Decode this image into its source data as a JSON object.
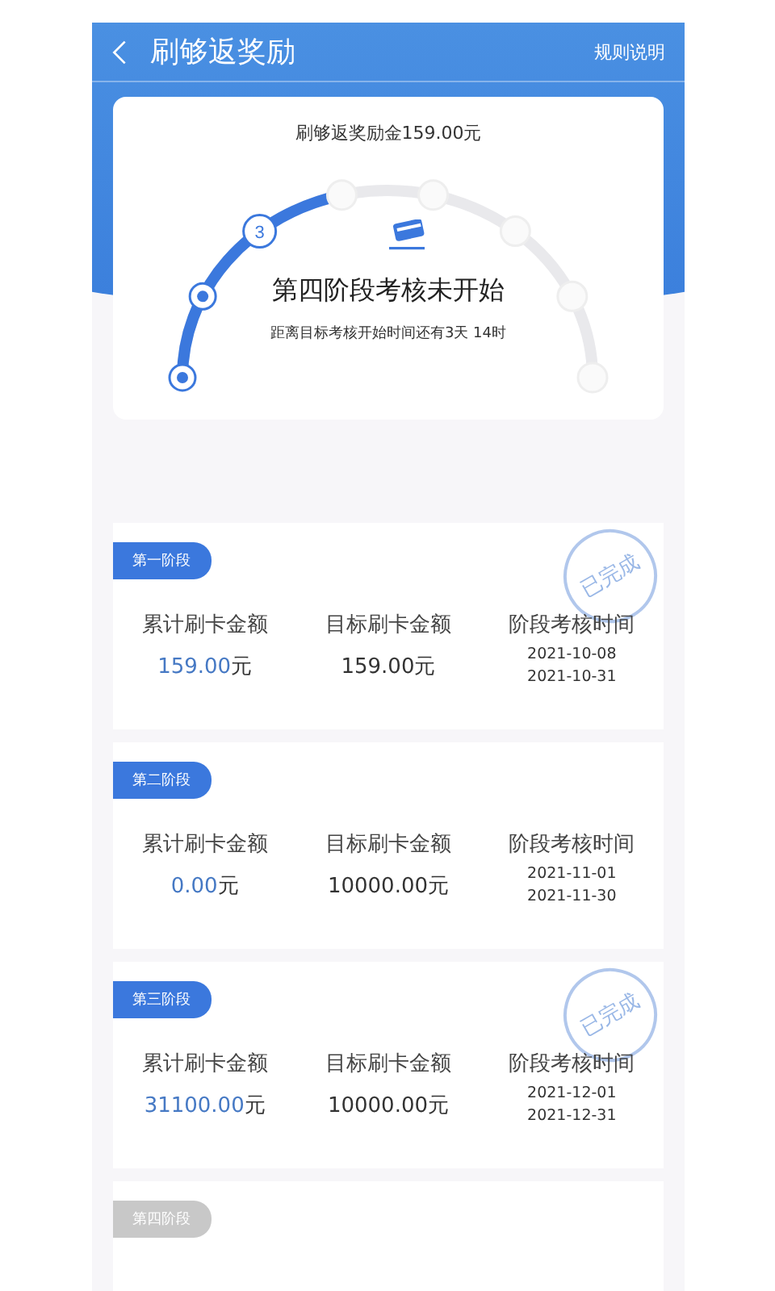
{
  "header": {
    "title": "刷够返奖励",
    "link": "规则说明"
  },
  "summary": {
    "reward": "刷够返奖励金159.00元",
    "status": "第四阶段考核未开始",
    "countdown": "距离目标考核开始时间还有3天 14时"
  },
  "progress": {
    "level": 0.43,
    "nodes": [
      {
        "kind": "done"
      },
      {
        "kind": "done"
      },
      {
        "kind": "current",
        "label": "3"
      },
      {
        "kind": "pending"
      },
      {
        "kind": "pending"
      },
      {
        "kind": "pending"
      },
      {
        "kind": "pending"
      },
      {
        "kind": "pending"
      }
    ]
  },
  "stages": [
    {
      "badge": "第一阶段",
      "active": true,
      "stamp": "已完成",
      "headings": [
        "累计刷卡金额",
        "目标刷卡金额",
        "阶段考核时间"
      ],
      "amount": "159.00",
      "amount_unit": "元",
      "target": "159.00元",
      "dates": [
        "2021-10-08",
        "2021-10-31"
      ]
    },
    {
      "badge": "第二阶段",
      "active": true,
      "headings": [
        "累计刷卡金额",
        "目标刷卡金额",
        "阶段考核时间"
      ],
      "amount": "0.00",
      "amount_unit": "元",
      "target": "10000.00元",
      "dates": [
        "2021-11-01",
        "2021-11-30"
      ]
    },
    {
      "badge": "第三阶段",
      "active": true,
      "stamp": "已完成",
      "headings": [
        "累计刷卡金额",
        "目标刷卡金额",
        "阶段考核时间"
      ],
      "amount": "31100.00",
      "amount_unit": "元",
      "target": "10000.00元",
      "dates": [
        "2021-12-01",
        "2021-12-31"
      ]
    },
    {
      "badge": "第四阶段",
      "active": false
    }
  ]
}
